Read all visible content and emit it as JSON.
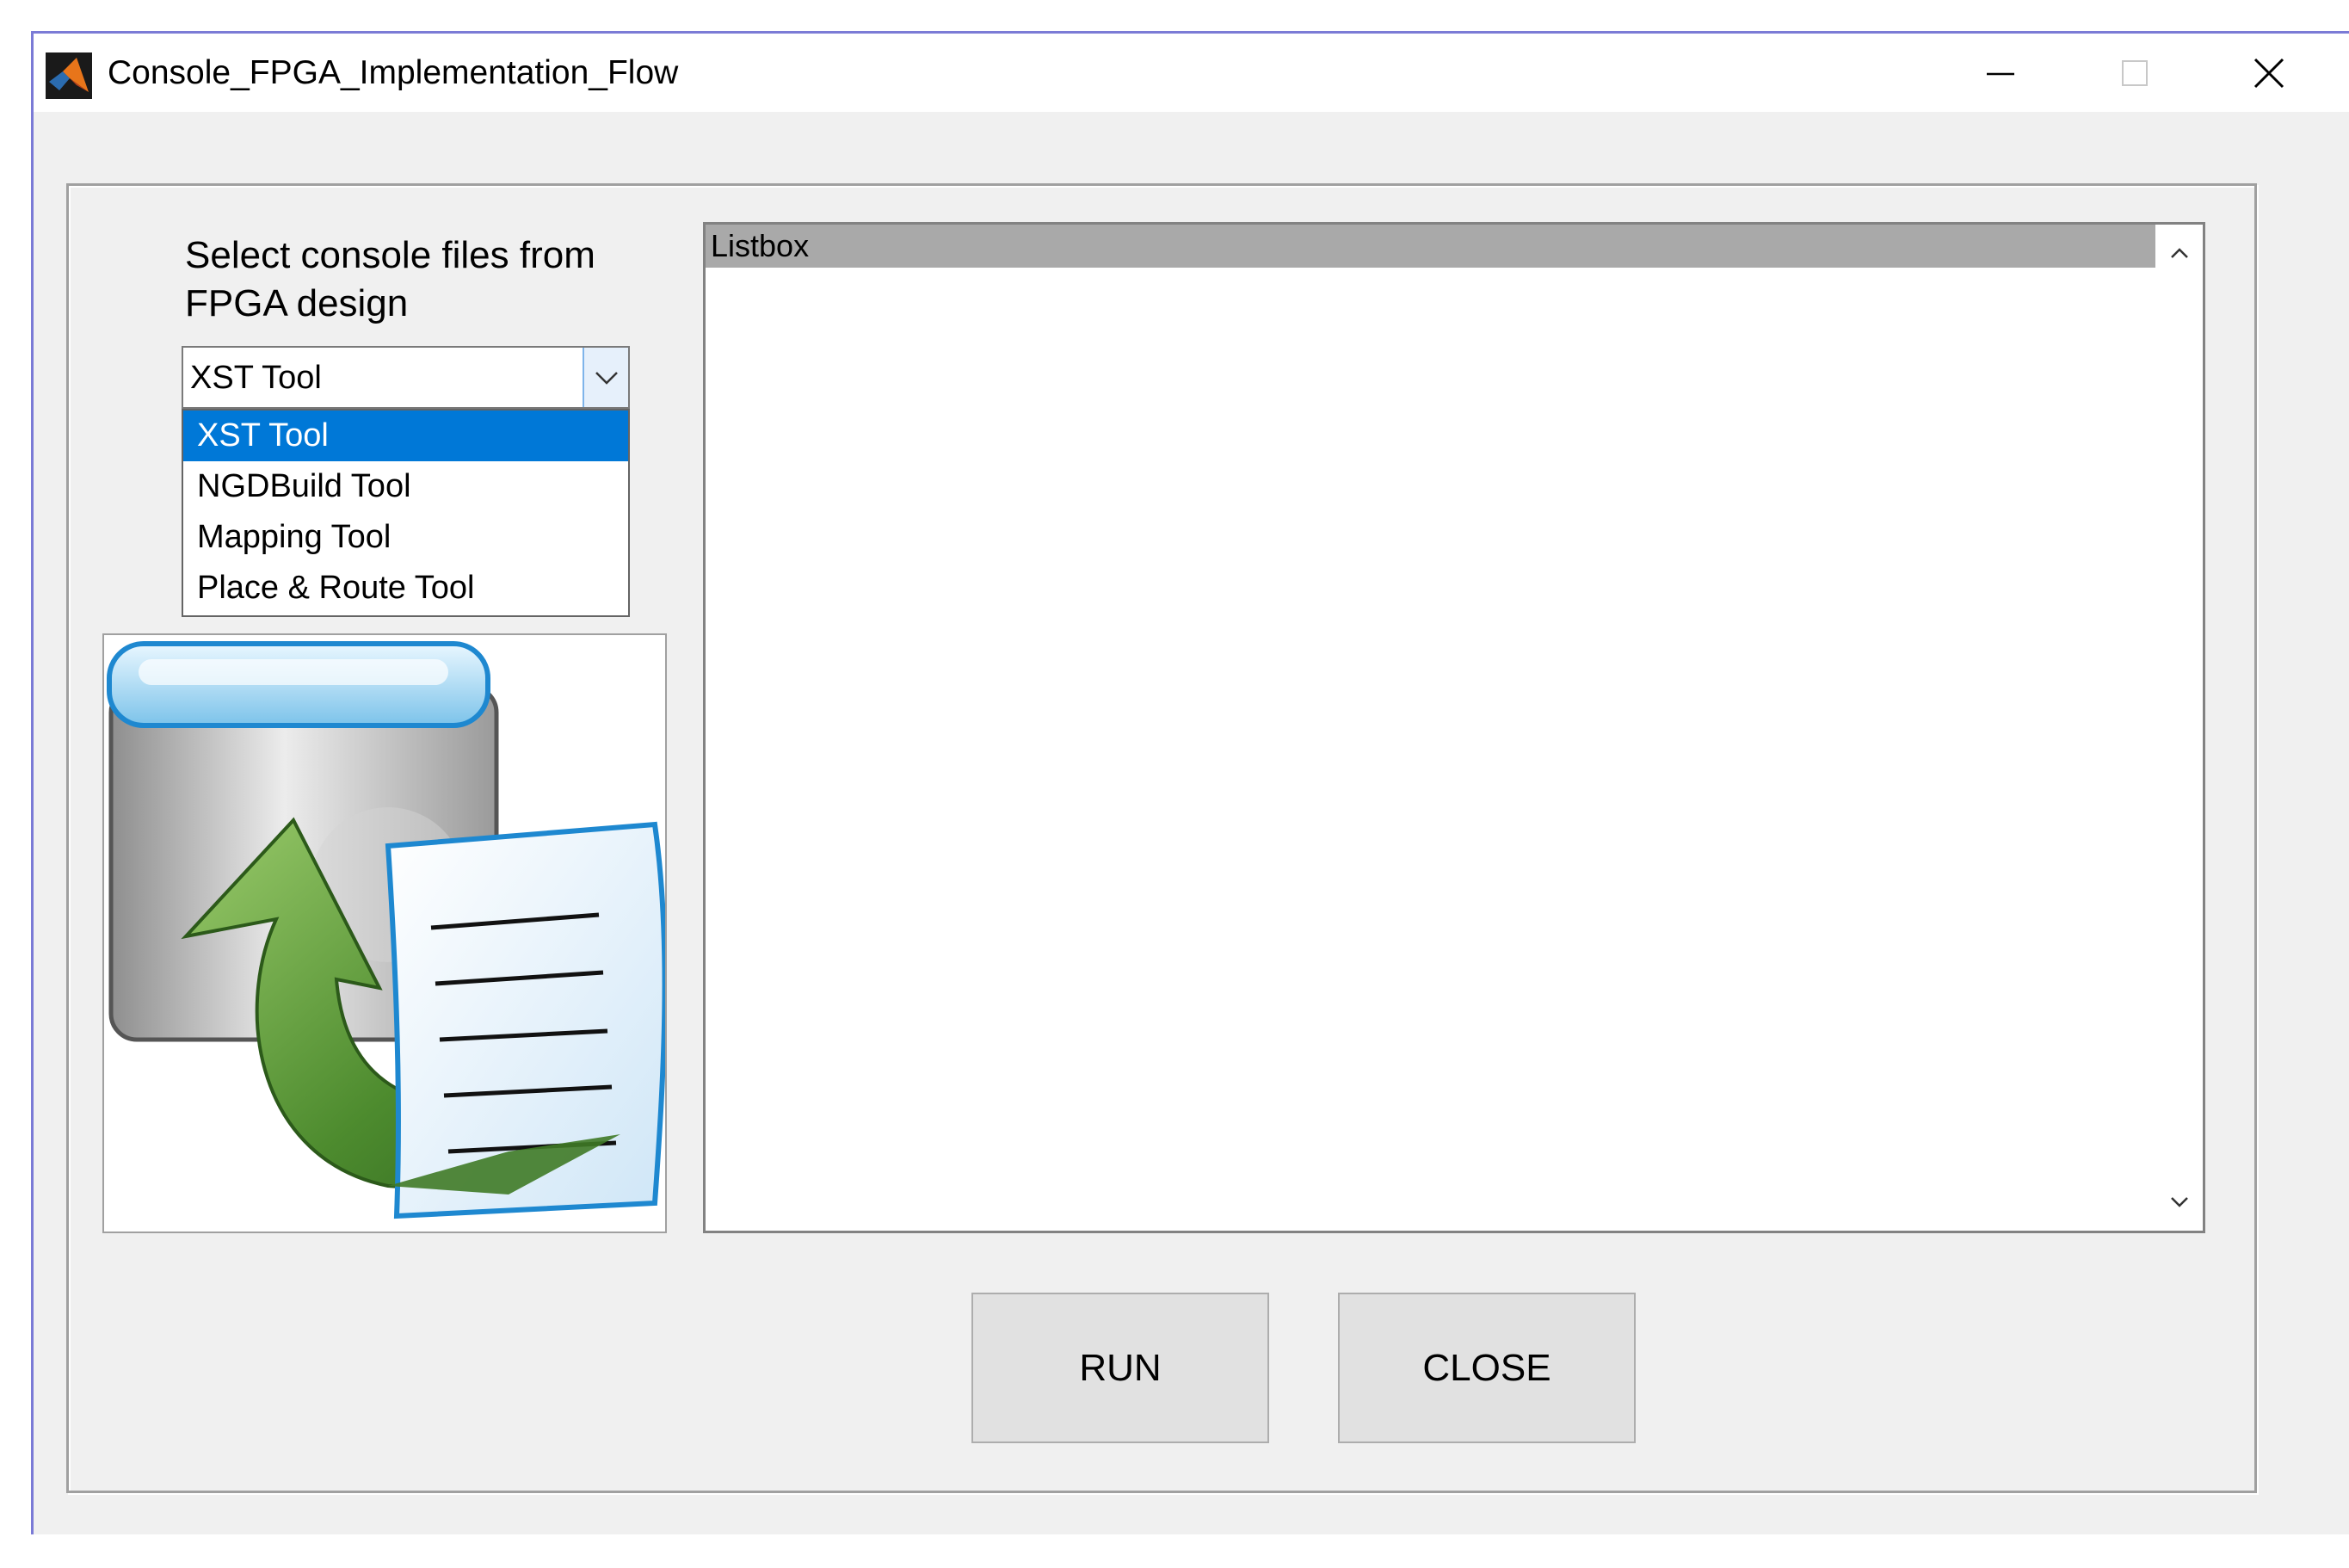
{
  "window": {
    "title": "Console_FPGA_Implementation_Flow",
    "icon": "matlab-logo-icon",
    "controls": [
      "minimize-icon",
      "maximize-icon",
      "close-icon"
    ]
  },
  "main": {
    "select_label": "Select console files from FPGA design",
    "dropdown": {
      "selected": "XST Tool",
      "options": [
        "XST Tool",
        "NGDBuild Tool",
        "Mapping Tool",
        "Place & Route Tool"
      ],
      "highlighted": "XST Tool"
    },
    "image": "console-export-document-icon",
    "listbox": {
      "items": [
        "Listbox"
      ]
    },
    "buttons": {
      "run": "RUN",
      "close": "CLOSE"
    }
  },
  "colors": {
    "window_bg": "#f0f0f0",
    "selection": "#0078d7",
    "listbox_item": "#a9a9a9",
    "button_bg": "#e1e1e1"
  }
}
